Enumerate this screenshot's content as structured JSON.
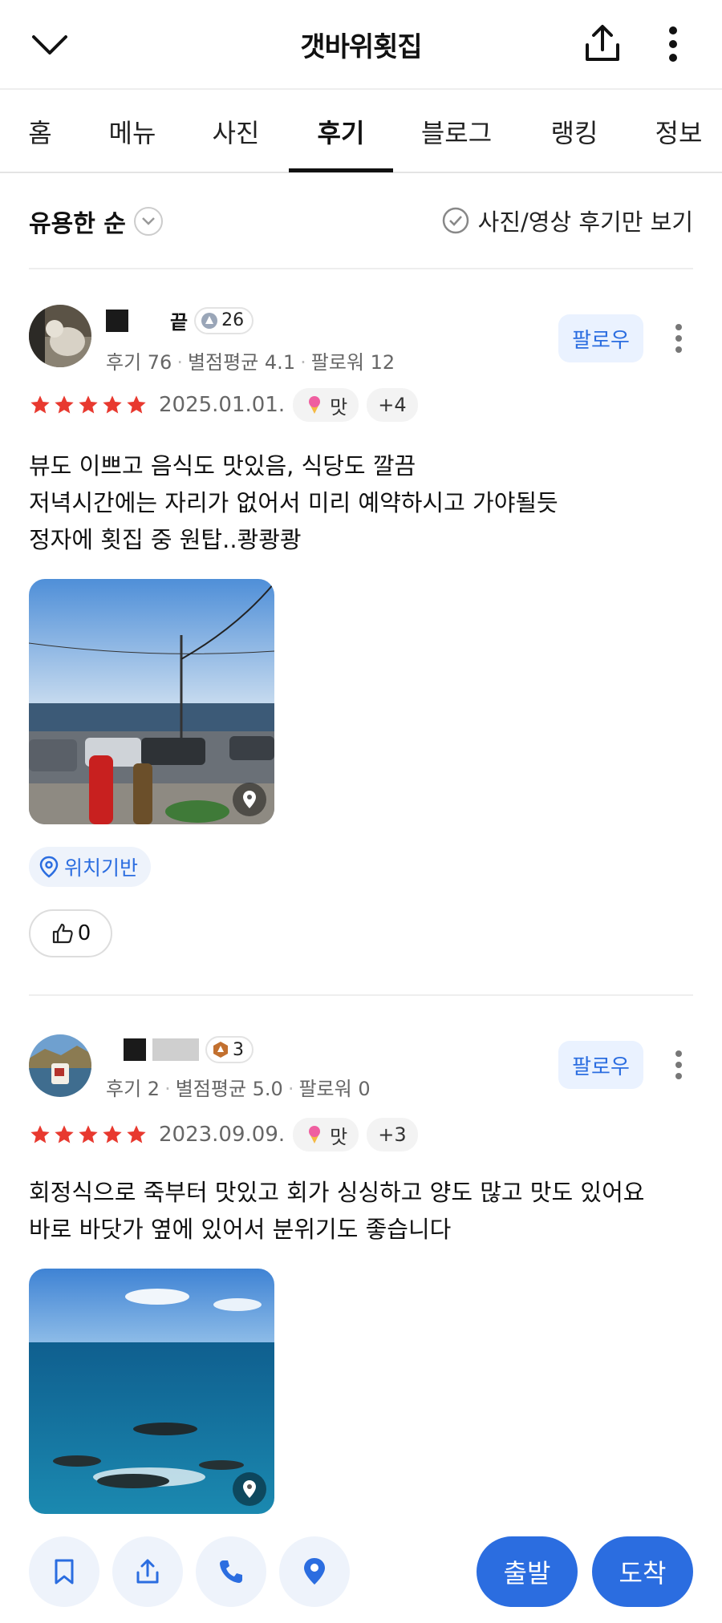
{
  "header": {
    "title": "갯바위횟집"
  },
  "tabs": [
    "홈",
    "메뉴",
    "사진",
    "후기",
    "블로그",
    "랭킹",
    "정보"
  ],
  "sortbar": {
    "sort_label": "유용한 순",
    "filter_label": "사진/영상 후기만 보기"
  },
  "reviews": [
    {
      "name_suffix": "끝",
      "level": "26",
      "stats": {
        "reviews": "후기 76",
        "avg": "별점평균 4.1",
        "followers": "팔로워 12"
      },
      "follow_label": "팔로우",
      "rating": 5,
      "date": "2025.01.01.",
      "tag": "맛",
      "more_tags": "+4",
      "lines": [
        "뷰도 이쁘고 음식도 맛있음, 식당도 깔끔",
        "저녁시간에는 자리가 없어서 미리 예약하시고 가야될듯",
        "정자에 횟집 중 원탑..쾅쾅쾅"
      ],
      "location_label": "위치기반",
      "likes": "0"
    },
    {
      "name_suffix": "",
      "level": "3",
      "stats": {
        "reviews": "후기 2",
        "avg": "별점평균 5.0",
        "followers": "팔로워 0"
      },
      "follow_label": "팔로우",
      "rating": 5,
      "date": "2023.09.09.",
      "tag": "맛",
      "more_tags": "+3",
      "lines": [
        "회정식으로 죽부터 맛있고 회가 싱싱하고 양도 많고 맛도 있어요",
        "바로 바닷가 옆에 있어서 분위기도 좋습니다"
      ]
    }
  ],
  "bottombar": {
    "depart_label": "출발",
    "arrive_label": "도착"
  },
  "colors": {
    "accent": "#2b6de0",
    "star": "#e8392f",
    "follow_bg": "#eaf2ff"
  }
}
